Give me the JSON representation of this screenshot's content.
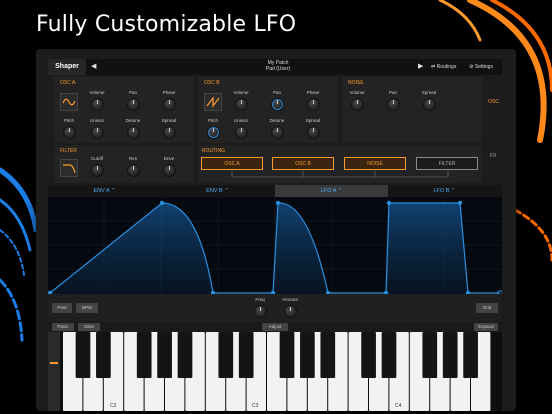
{
  "headline": "Fully Customizable LFO",
  "colors": {
    "accent": "#ff9a2b",
    "lfo_blue": "#2b8fe0",
    "background": "#000000"
  },
  "topbar": {
    "tab": "Shaper",
    "patch_name": "My Patch",
    "patch_bank": "Pad (User)",
    "routings": "Routings",
    "settings": "Settings",
    "prev_icon": "caret-left-icon",
    "next_icon": "caret-right-icon"
  },
  "osc_a": {
    "title": "OSC A",
    "knobs": [
      "Volume",
      "Pan",
      "Phase",
      "Pitch",
      "Unison",
      "Detune",
      "Spread"
    ]
  },
  "osc_b": {
    "title": "OSC B",
    "knobs": [
      "Volume",
      "Pan",
      "Phase",
      "Pitch",
      "Unison",
      "Detune",
      "Spread"
    ]
  },
  "noise": {
    "title": "NOISE",
    "knobs": [
      "Volume",
      "Pan",
      "Spread"
    ]
  },
  "filter": {
    "title": "FILTER",
    "knobs": [
      "Cutoff",
      "Res",
      "Drive"
    ]
  },
  "routing": {
    "title": "ROUTING",
    "boxes": [
      "OSC A",
      "OSC B",
      "NOISE",
      "FILTER"
    ]
  },
  "side_tabs": {
    "osc": "OSC",
    "fx": "FX"
  },
  "env_tabs": [
    "ENV A",
    "ENV B",
    "LFO A",
    "LFO B"
  ],
  "controls": {
    "free": "Free",
    "bpm": "BPM",
    "freq": "Freq",
    "amount": "Amount",
    "grid": "Grid"
  },
  "keyboard_header": {
    "panic": "Panic",
    "gliss": "Gliss",
    "adjust": "Adjust",
    "expand": "Expand"
  },
  "keyboard": {
    "octave_labels": [
      "C2",
      "C3",
      "C4"
    ]
  }
}
